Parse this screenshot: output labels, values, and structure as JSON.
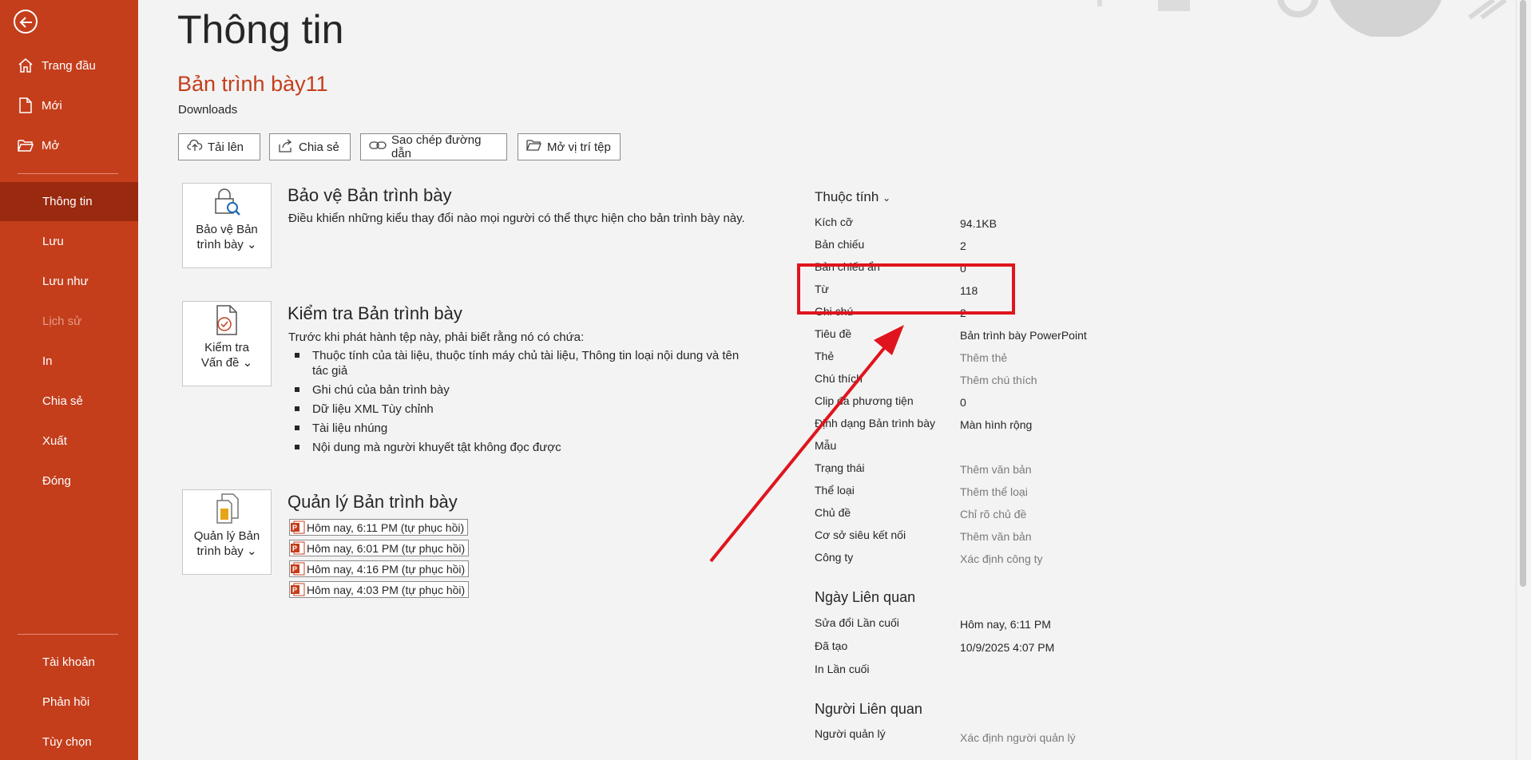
{
  "sidebar": {
    "items_top": [
      {
        "label": "Trang đầu",
        "icon": "home-icon"
      },
      {
        "label": "Mới",
        "icon": "new-document-icon"
      },
      {
        "label": "Mở",
        "icon": "open-folder-icon"
      }
    ],
    "items_middle": [
      {
        "label": "Thông tin",
        "state": "active"
      },
      {
        "label": "Lưu"
      },
      {
        "label": "Lưu như"
      },
      {
        "label": "Lịch sử",
        "state": "disabled"
      },
      {
        "label": "In"
      },
      {
        "label": "Chia sẻ"
      },
      {
        "label": "Xuất"
      },
      {
        "label": "Đóng"
      }
    ],
    "items_bottom": [
      {
        "label": "Tài khoản"
      },
      {
        "label": "Phản hồi"
      },
      {
        "label": "Tùy chọn"
      }
    ]
  },
  "header": {
    "title": "Thông tin",
    "doc_name": "Bản trình bày11",
    "doc_path": "Downloads"
  },
  "toolbar": {
    "upload": "Tải lên",
    "share": "Chia sẻ",
    "copy_path": "Sao chép đường dẫn",
    "open_location": "Mở vị trí tệp"
  },
  "protect": {
    "button_line1": "Bảo vệ Bản",
    "button_line2": "trình bày",
    "title": "Bảo vệ Bản trình bày",
    "desc": "Điều khiển những kiểu thay đổi nào mọi người có thể thực hiện cho bản trình bày này."
  },
  "inspect": {
    "button_line1": "Kiểm tra",
    "button_line2": "Vấn đề",
    "title": "Kiểm tra Bản trình bày",
    "desc": "Trước khi phát hành tệp này, phải biết rằng nó có chứa:",
    "bullets": [
      "Thuộc tính của tài liệu, thuộc tính máy chủ tài liệu, Thông tin loại nội dung và tên tác giả",
      "Ghi chú của bản trình bày",
      "Dữ liệu XML Tùy chỉnh",
      "Tài liệu nhúng",
      "Nội dung mà người khuyết tật không đọc được"
    ]
  },
  "manage": {
    "button_line1": "Quản lý Bản",
    "button_line2": "trình bày",
    "title": "Quản lý Bản trình bày",
    "versions": [
      "Hôm nay, 6:11 PM (tự phục hồi)",
      "Hôm nay, 6:01 PM (tự phục hồi)",
      "Hôm nay, 4:16 PM (tự phục hồi)",
      "Hôm nay, 4:03 PM (tự phục hồi)"
    ]
  },
  "properties": {
    "header": "Thuộc tính",
    "rows": [
      {
        "label": "Kích cỡ",
        "value": "94.1KB"
      },
      {
        "label": "Bản chiếu",
        "value": "2"
      },
      {
        "label": "Bản chiếu ẩn",
        "value": "0"
      },
      {
        "label": "Từ",
        "value": "118"
      },
      {
        "label": "Ghi chú",
        "value": "2"
      },
      {
        "label": "Tiêu đề",
        "value": "Bản trình bày PowerPoint"
      },
      {
        "label": "Thẻ",
        "value": "Thêm thẻ",
        "hint": true
      },
      {
        "label": "Chú thích",
        "value": "Thêm chú thích",
        "hint": true
      },
      {
        "label": "Clip đa phương tiện",
        "value": "0"
      },
      {
        "label": "Định dạng Bản trình bày",
        "value": "Màn hình rộng"
      },
      {
        "label": "Mẫu",
        "value": ""
      },
      {
        "label": "Trạng thái",
        "value": "Thêm văn bản",
        "hint": true
      },
      {
        "label": "Thể loại",
        "value": "Thêm thể loại",
        "hint": true
      },
      {
        "label": "Chủ đề",
        "value": "Chỉ rõ chủ đề",
        "hint": true
      },
      {
        "label": "Cơ sở siêu kết nối",
        "value": "Thêm văn bản",
        "hint": true
      },
      {
        "label": "Công ty",
        "value": "Xác định công ty",
        "hint": true
      }
    ]
  },
  "related_dates": {
    "header": "Ngày Liên quan",
    "rows": [
      {
        "label": "Sửa đổi Lần cuối",
        "value": "Hôm nay, 6:11 PM"
      },
      {
        "label": "Đã tạo",
        "value": "10/9/2025 4:07 PM"
      },
      {
        "label": "In Lần cuối",
        "value": ""
      }
    ]
  },
  "related_people": {
    "header": "Người Liên quan",
    "rows": [
      {
        "label": "Người quản lý",
        "value": "Xác định người quản lý",
        "hint": true
      }
    ]
  },
  "colors": {
    "accent": "#c43e1c",
    "sidebar_active": "#99290f",
    "annotation": "#e0141d"
  }
}
